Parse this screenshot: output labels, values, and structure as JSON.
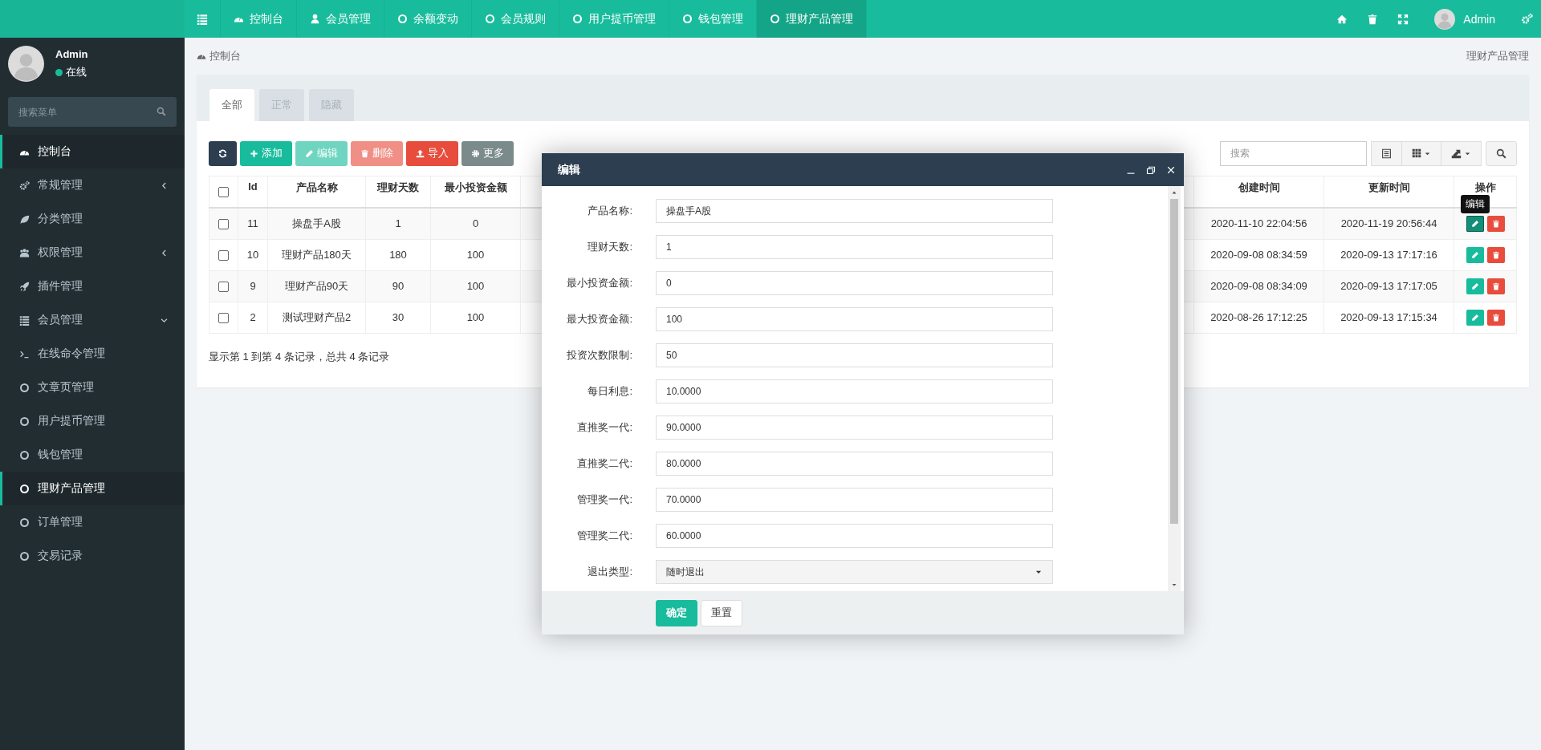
{
  "top_nav": {
    "items": [
      {
        "label": "控制台",
        "kind": "dashboard",
        "selected": false
      },
      {
        "label": "会员管理",
        "kind": "user",
        "selected": false
      },
      {
        "label": "余额变动",
        "kind": "circle",
        "selected": false
      },
      {
        "label": "会员规则",
        "kind": "circle",
        "selected": false
      },
      {
        "label": "用户提币管理",
        "kind": "circle",
        "selected": false
      },
      {
        "label": "钱包管理",
        "kind": "circle",
        "selected": false
      },
      {
        "label": "理财产品管理",
        "kind": "circle",
        "selected": true
      }
    ],
    "user": {
      "name": "Admin"
    }
  },
  "sidebar": {
    "user": {
      "name": "Admin",
      "status": "在线",
      "online": true
    },
    "search": {
      "placeholder": "搜索菜单"
    },
    "items": [
      {
        "label": "控制台",
        "kind": "dashboard",
        "selected": true
      },
      {
        "label": "常规管理",
        "kind": "cogs",
        "selected": false,
        "expanded": false
      },
      {
        "label": "分类管理",
        "kind": "leaf",
        "selected": false
      },
      {
        "label": "权限管理",
        "kind": "users",
        "selected": false,
        "expanded": false
      },
      {
        "label": "插件管理",
        "kind": "rocket",
        "selected": false
      },
      {
        "label": "会员管理",
        "kind": "list",
        "selected": false,
        "expanded": true,
        "children": [
          {
            "label": "在线命令管理",
            "kind": "terminal",
            "selected": false
          },
          {
            "label": "文章页管理",
            "kind": "circle",
            "selected": false
          },
          {
            "label": "用户提币管理",
            "kind": "circle",
            "selected": false
          },
          {
            "label": "钱包管理",
            "kind": "circle",
            "selected": false
          },
          {
            "label": "理财产品管理",
            "kind": "circle",
            "selected": true
          },
          {
            "label": "订单管理",
            "kind": "circle",
            "selected": false
          },
          {
            "label": "交易记录",
            "kind": "circle",
            "selected": false
          }
        ]
      }
    ]
  },
  "breadcrumb": {
    "label": "控制台"
  },
  "page_title": "理财产品管理",
  "tabs": [
    {
      "label": "全部",
      "selected": true
    },
    {
      "label": "正常",
      "selected": false
    },
    {
      "label": "隐藏",
      "selected": false
    }
  ],
  "toolbar": {
    "buttons": [
      {
        "kind": "refresh",
        "disabled": false
      },
      {
        "label": "添加",
        "kind": "add",
        "disabled": false
      },
      {
        "label": "编辑",
        "kind": "edit",
        "disabled": true
      },
      {
        "label": "删除",
        "kind": "delete",
        "disabled": true
      },
      {
        "label": "导入",
        "kind": "import",
        "disabled": false
      },
      {
        "label": "更多",
        "kind": "more",
        "disabled": false
      }
    ],
    "search": {
      "placeholder": "搜索"
    }
  },
  "table": {
    "header_checked": false,
    "columns": [
      "Id",
      "产品名称",
      "理财天数",
      "最小投资金额",
      "创建时间",
      "更新时间",
      "操作"
    ],
    "rows": [
      {
        "checked": false,
        "cells": [
          "11",
          "操盘手A股",
          "1",
          "0",
          "2020-11-10 22:04:56",
          "2020-11-19 20:56:44"
        ],
        "tooltip": "编辑"
      },
      {
        "checked": false,
        "cells": [
          "10",
          "理财产品180天",
          "180",
          "100",
          "2020-09-08 08:34:59",
          "2020-09-13 17:17:16"
        ]
      },
      {
        "checked": false,
        "cells": [
          "9",
          "理财产品90天",
          "90",
          "100",
          "2020-09-08 08:34:09",
          "2020-09-13 17:17:05"
        ]
      },
      {
        "checked": false,
        "cells": [
          "2",
          "测试理财产品2",
          "30",
          "100",
          "2020-08-26 17:12:25",
          "2020-09-13 17:15:34"
        ]
      }
    ]
  },
  "pagination": {
    "summary": "显示第 1 到第 4 条记录，总共 4 条记录"
  },
  "modal": {
    "title": "编辑",
    "fields": [
      {
        "label": "产品名称:",
        "value": "操盘手A股",
        "kind": "text"
      },
      {
        "label": "理财天数:",
        "value": "1",
        "kind": "text"
      },
      {
        "label": "最小投资金额:",
        "value": "0",
        "kind": "text"
      },
      {
        "label": "最大投资金额:",
        "value": "100",
        "kind": "text"
      },
      {
        "label": "投资次数限制:",
        "value": "50",
        "kind": "text"
      },
      {
        "label": "每日利息:",
        "value": "10.0000",
        "kind": "text"
      },
      {
        "label": "直推奖一代:",
        "value": "90.0000",
        "kind": "text"
      },
      {
        "label": "直推奖二代:",
        "value": "80.0000",
        "kind": "text"
      },
      {
        "label": "管理奖一代:",
        "value": "70.0000",
        "kind": "text"
      },
      {
        "label": "管理奖二代:",
        "value": "60.0000",
        "kind": "text"
      },
      {
        "label": "退出类型:",
        "value": "随时退出",
        "kind": "select"
      }
    ],
    "buttons": [
      {
        "label": "确定",
        "kind": "primary"
      },
      {
        "label": "重置",
        "kind": "default"
      }
    ]
  }
}
